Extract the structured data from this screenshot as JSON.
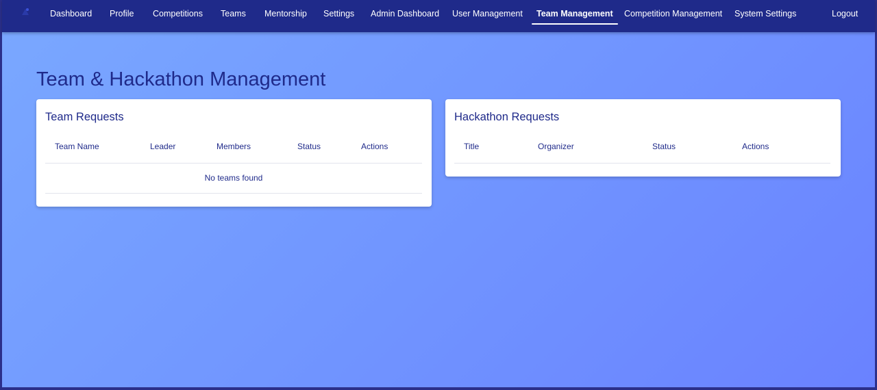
{
  "nav": {
    "items": [
      "Dashboard",
      "Profile",
      "Competitions",
      "Teams",
      "Mentorship",
      "Settings",
      "Admin Dashboard",
      "User Management",
      "Team Management",
      "Competition Management",
      "System Settings"
    ],
    "logout": "Logout",
    "active": "Team Management"
  },
  "page": {
    "title": "Team & Hackathon Management"
  },
  "team_requests": {
    "title": "Team Requests",
    "columns": [
      "Team Name",
      "Leader",
      "Members",
      "Status",
      "Actions"
    ],
    "empty": "No teams found"
  },
  "hackathon_requests": {
    "title": "Hackathon Requests",
    "columns": [
      "Title",
      "Organizer",
      "Status",
      "Actions"
    ]
  },
  "colors": {
    "nav_bg": "#1f2a8a",
    "accent_text": "#1f2a8a",
    "bg_gradient_start": "#7aa8ff",
    "bg_gradient_end": "#6a82ff"
  }
}
